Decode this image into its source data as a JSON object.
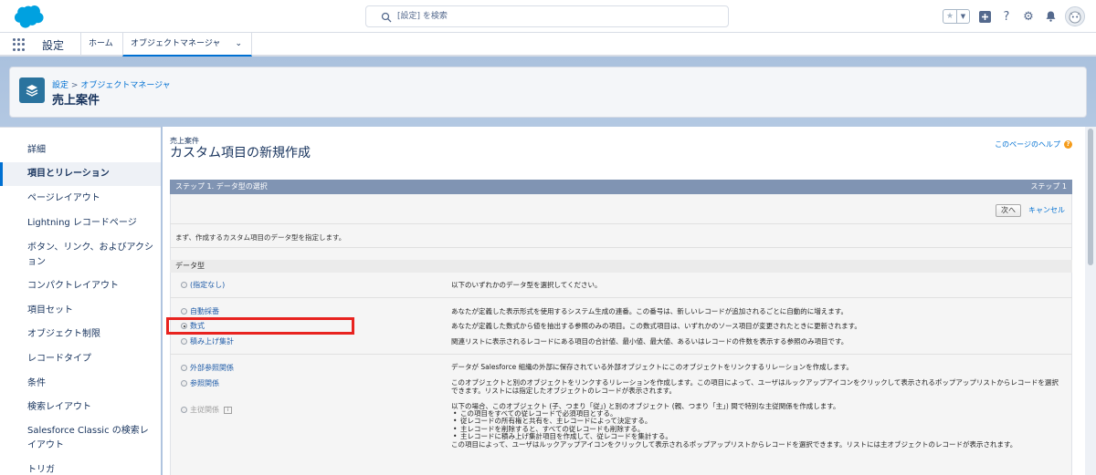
{
  "header": {
    "search_placeholder": "[設定] を検索"
  },
  "nav": {
    "app_name": "設定",
    "tabs": [
      {
        "label": "ホーム"
      },
      {
        "label": "オブジェクトマネージャ"
      }
    ]
  },
  "page_header": {
    "breadcrumb_setup": "設定",
    "breadcrumb_sep": ">",
    "breadcrumb_object_manager": "オブジェクトマネージャ",
    "title": "売上案件"
  },
  "sidebar": {
    "items": [
      {
        "label": "詳細"
      },
      {
        "label": "項目とリレーション"
      },
      {
        "label": "ページレイアウト"
      },
      {
        "label": "Lightning レコードページ"
      },
      {
        "label": "ボタン、リンク、およびアクション"
      },
      {
        "label": "コンパクトレイアウト"
      },
      {
        "label": "項目セット"
      },
      {
        "label": "オブジェクト制限"
      },
      {
        "label": "レコードタイプ"
      },
      {
        "label": "条件"
      },
      {
        "label": "検索レイアウト"
      },
      {
        "label": "Salesforce Classic の検索レイアウト"
      },
      {
        "label": "トリガ"
      }
    ]
  },
  "main": {
    "object_label": "売上案件",
    "title": "カスタム項目の新規作成",
    "help_link": "このページのヘルプ",
    "step_title": "ステップ 1. データ型の選択",
    "step_number": "ステップ 1",
    "next_button": "次へ",
    "cancel_link": "キャンセル",
    "intro": "まず、作成するカスタム項目のデータ型を指定します。",
    "section_title": "データ型",
    "options": [
      {
        "label": "(指定なし)",
        "desc": "以下のいずれかのデータ型を選択してください。"
      },
      {
        "label": "自動採番",
        "desc": "あなたが定義した表示形式を使用するシステム生成の連番。この番号は、新しいレコードが追加されるごとに自動的に増えます。"
      },
      {
        "label": "数式",
        "desc": "あなたが定義した数式から値を抽出する参照のみの項目。この数式項目は、いずれかのソース項目が変更されたときに更新されます。"
      },
      {
        "label": "積み上げ集計",
        "desc": "関連リストに表示されるレコードにある項目の合計値、最小値、最大値、あるいはレコードの件数を表示する参照のみ項目です。"
      },
      {
        "label": "外部参照関係",
        "desc": "データが Salesforce 組織の外部に保存されている外部オブジェクトにこのオブジェクトをリンクするリレーションを作成します。"
      },
      {
        "label": "参照関係",
        "desc": "このオブジェクトと別のオブジェクトをリンクするリレーションを作成します。この項目によって、ユーザはルックアップアイコンをクリックして表示されるポップアップリストからレコードを選択できます。リストには指定したオブジェクトのレコードが表示されます。"
      },
      {
        "label": "主従関係",
        "info": "i",
        "desc": "以下の場合、このオブジェクト (子、つまり「従」) と別のオブジェクト (親、つまり「主」) 間で特別な主従関係を作成します。"
      }
    ],
    "master_detail_bullets": [
      "この項目をすべての従レコードで必須項目とする。",
      "従レコードの所有権と共有を、主レコードによって決定する。",
      "主レコードを削除すると、すべての従レコードも削除する。",
      "主レコードに積み上げ集計項目を作成して、従レコードを集計する。"
    ],
    "master_detail_footer": "この項目によって、ユーザはルックアップアイコンをクリックして表示されるポップアップリストからレコードを選択できます。リストには主オブジェクトのレコードが表示されます。"
  },
  "colors": {
    "brand": "#00a1e0",
    "link": "#0070d2",
    "highlight": "#e8231f"
  }
}
